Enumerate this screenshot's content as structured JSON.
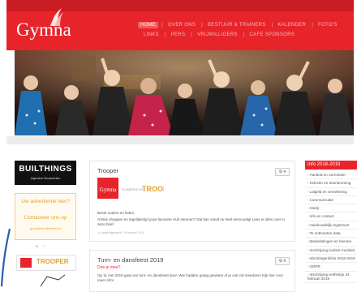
{
  "brand": {
    "logo_text": "Gymna",
    "accent": "#e8242b"
  },
  "nav": {
    "row1": [
      "HOME",
      "OVER ONS",
      "BESTUUR & TRAINERS",
      "KALENDER",
      "FOTO'S"
    ],
    "row2": [
      "LINKS",
      "PERS",
      "VRIJWILLIGERS",
      "CAFE SPONSORS"
    ],
    "active": "HOME"
  },
  "left_sidebar": {
    "sponsor_title": "BUILTHINGS",
    "sponsor_subtitle": "Algemene Bouwwerken",
    "ad_line1": "Uw advertentie hier?",
    "ad_line2": "Contacteer ons op",
    "ad_email": "gymnaleden@telenet.be",
    "mini_logo_text": "TROOPER"
  },
  "articles": [
    {
      "title": "Trooper",
      "subtitle": "",
      "image_caption": "POWERED BY",
      "image_brand": "TROOPER",
      "image_logo": "Gymna",
      "greeting": "Beste ouders en leden,",
      "text": "Online shoppen en tegelijkertijd jouw favoriete club steunen? Dat kan vanaf nu heel eenvoudig! Lees er alles over in deze brief",
      "meta": "Laatst bijgewerkt: 16 februari 2019",
      "gear": "⚙ ▾"
    },
    {
      "title": "Turn- en dansfeest 2019",
      "subtitle": "Doe je mee?",
      "text": "Op 11 mei 2019 gaat ons turn- en dansfeest door. Wie hadden graag geweten of je ook zal meedoen! Kijk hier voor meer info!",
      "gear": "⚙ ▾"
    }
  ],
  "right_sidebar": {
    "heading": "Info 2018-2019",
    "items": [
      "Aanbod en uurrooster",
      "Selectie en doorstroming",
      "Lidgeld en verzekering",
      "Communicatie",
      "Kledij",
      "Info en contact",
      "Huishoudelijk reglement",
      "Te ontmoeten data",
      "Mededelingen en brieven",
      "Inschrijving (online module)",
      "Inlichtingenfiche 2018-2019",
      "GDPR",
      "Inschrijving eetfestijn 24 februari 2019"
    ]
  }
}
